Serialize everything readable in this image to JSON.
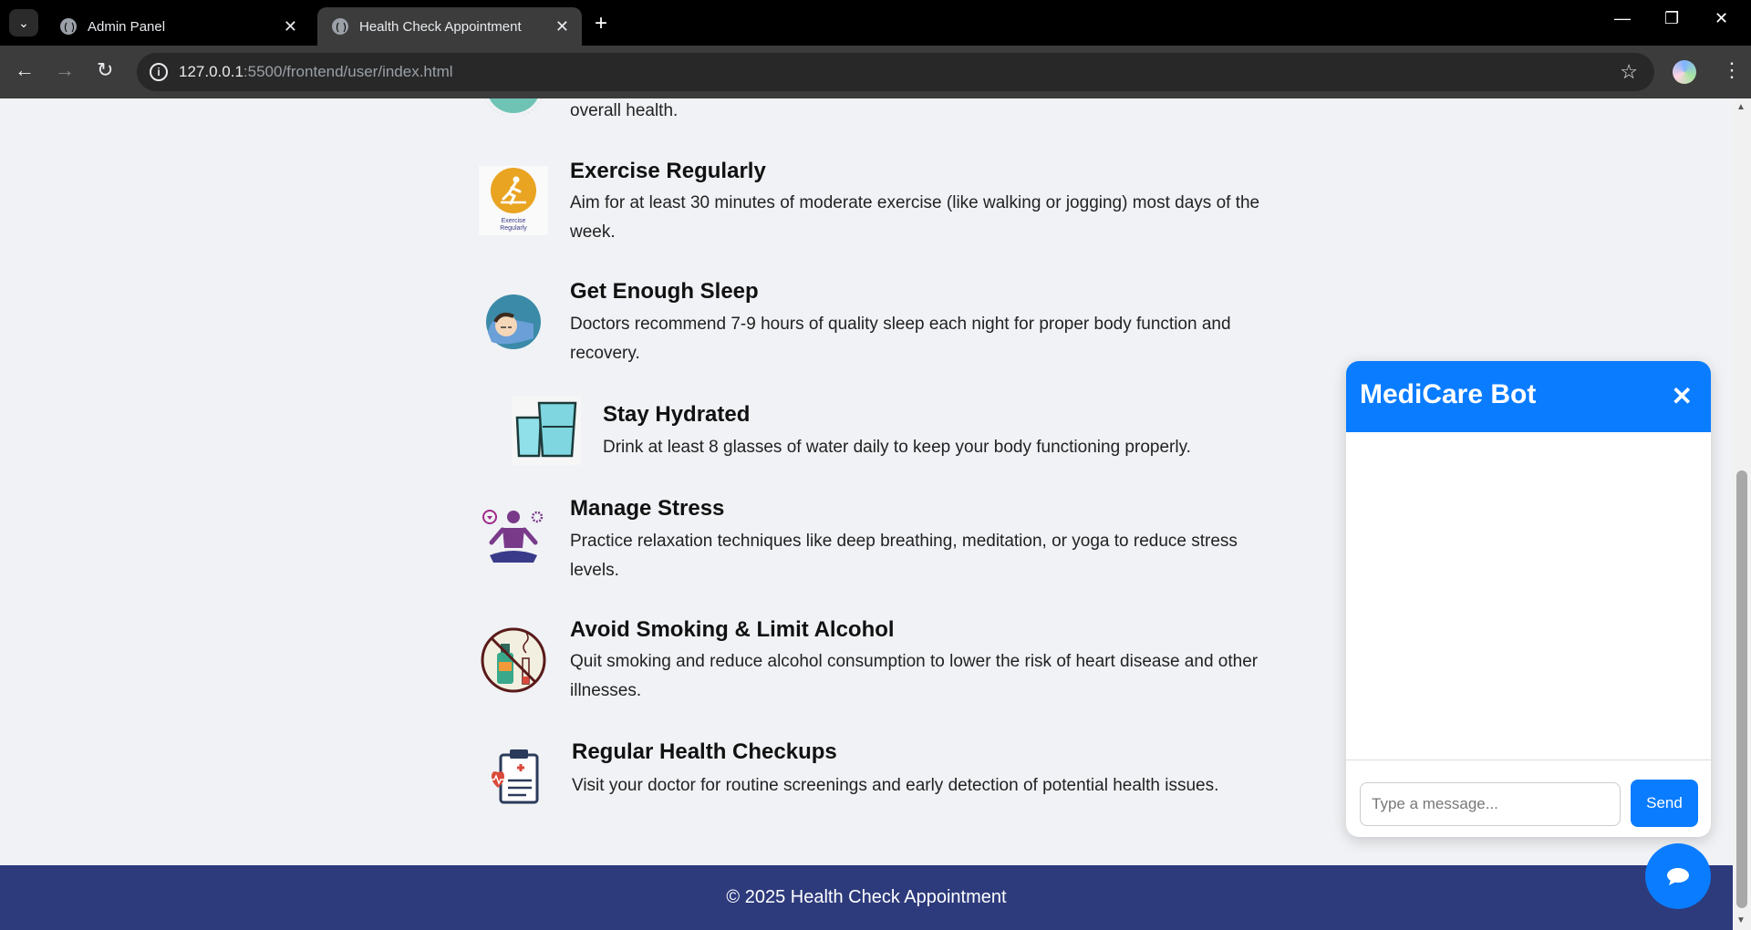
{
  "browser": {
    "tabs": [
      {
        "title": "Admin Panel"
      },
      {
        "title": "Health Check Appointment"
      }
    ],
    "url_host": "127.0.0.1",
    "url_rest": ":5500/frontend/user/index.html"
  },
  "tips": {
    "partial_text": "overall health.",
    "items": [
      {
        "title": "Exercise Regularly",
        "desc": "Aim for at least 30 minutes of moderate exercise (like walking or jogging) most days of the week.",
        "icon_caption": "Exercise Regularly"
      },
      {
        "title": "Get Enough Sleep",
        "desc": "Doctors recommend 7-9 hours of quality sleep each night for proper body function and recovery."
      },
      {
        "title": "Stay Hydrated",
        "desc": "Drink at least 8 glasses of water daily to keep your body functioning properly."
      },
      {
        "title": "Manage Stress",
        "desc": "Practice relaxation techniques like deep breathing, meditation, or yoga to reduce stress levels."
      },
      {
        "title": "Avoid Smoking & Limit Alcohol",
        "desc": "Quit smoking and reduce alcohol consumption to lower the risk of heart disease and other illnesses."
      },
      {
        "title": "Regular Health Checkups",
        "desc": "Visit your doctor for routine screenings and early detection of potential health issues."
      }
    ]
  },
  "footer": {
    "text": "© 2025 Health Check Appointment"
  },
  "chat": {
    "title": "MediCare Bot",
    "close": "✕",
    "placeholder": "Type a message...",
    "send": "Send"
  },
  "colors": {
    "accent": "#0a7cff",
    "footer": "#2d3a7c"
  }
}
